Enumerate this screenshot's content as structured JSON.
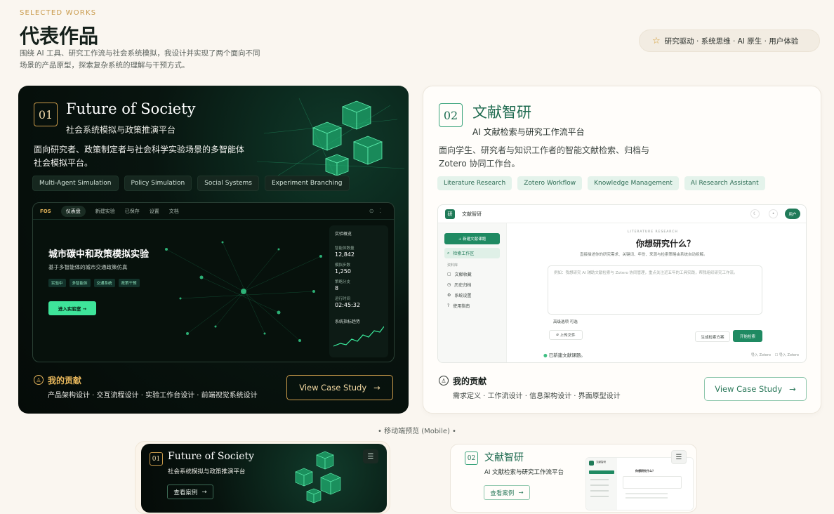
{
  "header": {
    "eyebrow": "SELECTED WORKS",
    "title": "代表作品",
    "description": "围绕 AI 工具、研究工作流与社会系统模拟，我设计并实现了两个面向不同场景的产品原型，探索复杂系统的理解与干预方式。",
    "pill": "研究驱动 · 系统思维 · AI 原生 · 用户体验"
  },
  "project1": {
    "number": "01",
    "title": "Future of Society",
    "subtitle": "社会系统模拟与政策推演平台",
    "description": "面向研究者、政策制定者与社会科学实验场景的多智能体社会模拟平台。",
    "tags": [
      "Multi-Agent Simulation",
      "Policy Simulation",
      "Social Systems",
      "Experiment Branching"
    ],
    "dashboard": {
      "logo": "FOS",
      "nav": [
        "仪表盘",
        "新建实验",
        "已保存",
        "设置",
        "文档"
      ],
      "hero_title": "城市碳中和政策模拟实验",
      "hero_subtitle": "基于多智能体的城市交通政策仿真",
      "chips": [
        "实验中",
        "多智能体",
        "交通系统",
        "政策干预"
      ],
      "enter_button": "进入实验室 →",
      "stats_title": "实验概览",
      "stats": [
        {
          "label": "智能体数量",
          "value": "12,842"
        },
        {
          "label": "模拟步数",
          "value": "1,250"
        },
        {
          "label": "策略分支",
          "value": "8"
        },
        {
          "label": "运行时间",
          "value": "02:45:32"
        }
      ],
      "trend_title": "系统指标趋势"
    },
    "contribution_title": "我的贡献",
    "contribution_items": "产品架构设计 · 交互流程设计 · 实验工作台设计 · 前端视觉系统设计",
    "case_button": "View Case Study"
  },
  "project2": {
    "number": "02",
    "title": "文献智研",
    "subtitle": "AI 文献检索与研究工作流平台",
    "description": "面向学生、研究者与知识工作者的智能文献检索、归档与 Zotero 协同工作台。",
    "tags": [
      "Literature Research",
      "Zotero Workflow",
      "Knowledge Management",
      "AI Research Assistant"
    ],
    "app": {
      "logo_char": "研",
      "name": "文献智研",
      "user": "用户",
      "new_button": "+ 新建文献课题",
      "side_items": [
        "检索工作区",
        "文献收藏",
        "历史归档",
        "系统设置",
        "使用指南"
      ],
      "side_section": "资料库",
      "eyebrow": "LITERATURE RESEARCH",
      "title": "你想研究什么？",
      "subtitle": "直接描述你的研究需求、关键词、年份、来源与检索策略由系统自动拆解。",
      "placeholder": "例如：我想研究 AI 辅助文献检索与 Zotero 协同管理，重点关注近五年的工具实践，帮我组织研究工作流。",
      "advanced": "高级选项 可选",
      "upload": "上传文件",
      "plan_button": "生成检索方案",
      "start_button": "开始检索",
      "status": "已新建文献课题。",
      "import1": "导入 Zotero",
      "import2": "导入 Zotero"
    },
    "contribution_title": "我的贡献",
    "contribution_items": "需求定义 · 工作流设计 · 信息架构设计 · 界面原型设计",
    "case_button": "View Case Study"
  },
  "mobile": {
    "label": "• 移动端预览 (Mobile) •",
    "card1": {
      "number": "01",
      "title": "Future of Society",
      "subtitle": "社会系统模拟与政策推演平台",
      "button": "查看案例"
    },
    "card2": {
      "number": "02",
      "title": "文献智研",
      "subtitle": "AI 文献检索与研究工作流平台",
      "button": "查看案例",
      "shot_app_name": "文献智研",
      "shot_title": "你想研究什么？"
    }
  },
  "colors": {
    "gold": "#c99a4a",
    "green": "#1f8a62",
    "dark": "#07110c"
  }
}
